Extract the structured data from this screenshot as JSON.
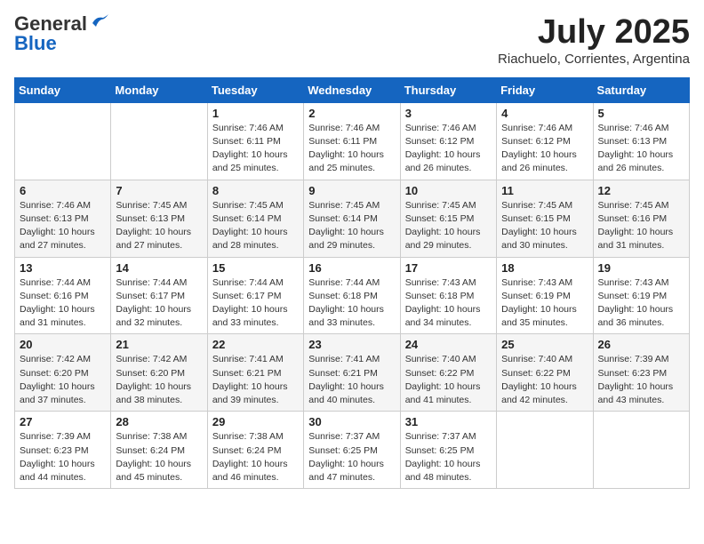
{
  "header": {
    "logo_general": "General",
    "logo_blue": "Blue",
    "month_title": "July 2025",
    "subtitle": "Riachuelo, Corrientes, Argentina"
  },
  "days_of_week": [
    "Sunday",
    "Monday",
    "Tuesday",
    "Wednesday",
    "Thursday",
    "Friday",
    "Saturday"
  ],
  "weeks": [
    [
      {
        "day": "",
        "info": ""
      },
      {
        "day": "",
        "info": ""
      },
      {
        "day": "1",
        "info": "Sunrise: 7:46 AM\nSunset: 6:11 PM\nDaylight: 10 hours and 25 minutes."
      },
      {
        "day": "2",
        "info": "Sunrise: 7:46 AM\nSunset: 6:11 PM\nDaylight: 10 hours and 25 minutes."
      },
      {
        "day": "3",
        "info": "Sunrise: 7:46 AM\nSunset: 6:12 PM\nDaylight: 10 hours and 26 minutes."
      },
      {
        "day": "4",
        "info": "Sunrise: 7:46 AM\nSunset: 6:12 PM\nDaylight: 10 hours and 26 minutes."
      },
      {
        "day": "5",
        "info": "Sunrise: 7:46 AM\nSunset: 6:13 PM\nDaylight: 10 hours and 26 minutes."
      }
    ],
    [
      {
        "day": "6",
        "info": "Sunrise: 7:46 AM\nSunset: 6:13 PM\nDaylight: 10 hours and 27 minutes."
      },
      {
        "day": "7",
        "info": "Sunrise: 7:45 AM\nSunset: 6:13 PM\nDaylight: 10 hours and 27 minutes."
      },
      {
        "day": "8",
        "info": "Sunrise: 7:45 AM\nSunset: 6:14 PM\nDaylight: 10 hours and 28 minutes."
      },
      {
        "day": "9",
        "info": "Sunrise: 7:45 AM\nSunset: 6:14 PM\nDaylight: 10 hours and 29 minutes."
      },
      {
        "day": "10",
        "info": "Sunrise: 7:45 AM\nSunset: 6:15 PM\nDaylight: 10 hours and 29 minutes."
      },
      {
        "day": "11",
        "info": "Sunrise: 7:45 AM\nSunset: 6:15 PM\nDaylight: 10 hours and 30 minutes."
      },
      {
        "day": "12",
        "info": "Sunrise: 7:45 AM\nSunset: 6:16 PM\nDaylight: 10 hours and 31 minutes."
      }
    ],
    [
      {
        "day": "13",
        "info": "Sunrise: 7:44 AM\nSunset: 6:16 PM\nDaylight: 10 hours and 31 minutes."
      },
      {
        "day": "14",
        "info": "Sunrise: 7:44 AM\nSunset: 6:17 PM\nDaylight: 10 hours and 32 minutes."
      },
      {
        "day": "15",
        "info": "Sunrise: 7:44 AM\nSunset: 6:17 PM\nDaylight: 10 hours and 33 minutes."
      },
      {
        "day": "16",
        "info": "Sunrise: 7:44 AM\nSunset: 6:18 PM\nDaylight: 10 hours and 33 minutes."
      },
      {
        "day": "17",
        "info": "Sunrise: 7:43 AM\nSunset: 6:18 PM\nDaylight: 10 hours and 34 minutes."
      },
      {
        "day": "18",
        "info": "Sunrise: 7:43 AM\nSunset: 6:19 PM\nDaylight: 10 hours and 35 minutes."
      },
      {
        "day": "19",
        "info": "Sunrise: 7:43 AM\nSunset: 6:19 PM\nDaylight: 10 hours and 36 minutes."
      }
    ],
    [
      {
        "day": "20",
        "info": "Sunrise: 7:42 AM\nSunset: 6:20 PM\nDaylight: 10 hours and 37 minutes."
      },
      {
        "day": "21",
        "info": "Sunrise: 7:42 AM\nSunset: 6:20 PM\nDaylight: 10 hours and 38 minutes."
      },
      {
        "day": "22",
        "info": "Sunrise: 7:41 AM\nSunset: 6:21 PM\nDaylight: 10 hours and 39 minutes."
      },
      {
        "day": "23",
        "info": "Sunrise: 7:41 AM\nSunset: 6:21 PM\nDaylight: 10 hours and 40 minutes."
      },
      {
        "day": "24",
        "info": "Sunrise: 7:40 AM\nSunset: 6:22 PM\nDaylight: 10 hours and 41 minutes."
      },
      {
        "day": "25",
        "info": "Sunrise: 7:40 AM\nSunset: 6:22 PM\nDaylight: 10 hours and 42 minutes."
      },
      {
        "day": "26",
        "info": "Sunrise: 7:39 AM\nSunset: 6:23 PM\nDaylight: 10 hours and 43 minutes."
      }
    ],
    [
      {
        "day": "27",
        "info": "Sunrise: 7:39 AM\nSunset: 6:23 PM\nDaylight: 10 hours and 44 minutes."
      },
      {
        "day": "28",
        "info": "Sunrise: 7:38 AM\nSunset: 6:24 PM\nDaylight: 10 hours and 45 minutes."
      },
      {
        "day": "29",
        "info": "Sunrise: 7:38 AM\nSunset: 6:24 PM\nDaylight: 10 hours and 46 minutes."
      },
      {
        "day": "30",
        "info": "Sunrise: 7:37 AM\nSunset: 6:25 PM\nDaylight: 10 hours and 47 minutes."
      },
      {
        "day": "31",
        "info": "Sunrise: 7:37 AM\nSunset: 6:25 PM\nDaylight: 10 hours and 48 minutes."
      },
      {
        "day": "",
        "info": ""
      },
      {
        "day": "",
        "info": ""
      }
    ]
  ]
}
